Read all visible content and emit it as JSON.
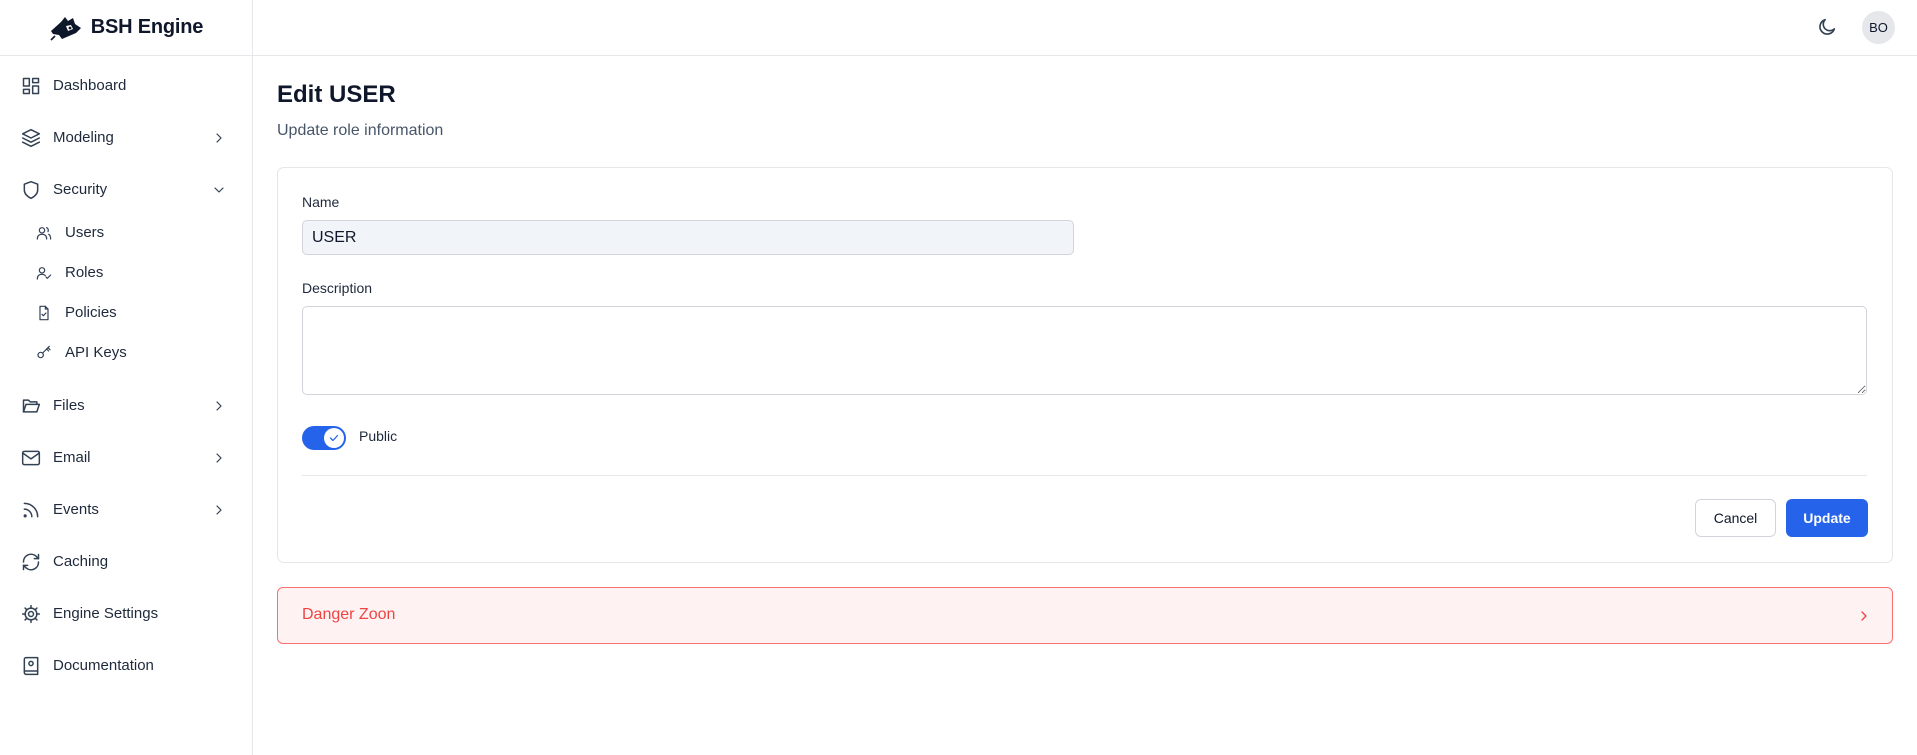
{
  "app": {
    "name": "BSH Engine"
  },
  "sidebar": {
    "items": [
      {
        "label": "Dashboard",
        "icon": "dashboard-icon"
      },
      {
        "label": "Modeling",
        "icon": "layers-icon",
        "expandable": true
      },
      {
        "label": "Security",
        "icon": "shield-icon",
        "expanded": true,
        "children": [
          {
            "label": "Users",
            "icon": "users-icon"
          },
          {
            "label": "Roles",
            "icon": "user-check-icon"
          },
          {
            "label": "Policies",
            "icon": "file-check-icon"
          },
          {
            "label": "API Keys",
            "icon": "key-icon"
          }
        ]
      },
      {
        "label": "Files",
        "icon": "folder-open-icon",
        "expandable": true
      },
      {
        "label": "Email",
        "icon": "mail-icon",
        "expandable": true
      },
      {
        "label": "Events",
        "icon": "rss-icon",
        "expandable": true
      },
      {
        "label": "Caching",
        "icon": "refresh-icon"
      },
      {
        "label": "Engine Settings",
        "icon": "gear-icon"
      },
      {
        "label": "Documentation",
        "icon": "book-icon"
      }
    ]
  },
  "topbar": {
    "theme_icon": "moon-icon",
    "avatar_initials": "BO"
  },
  "page": {
    "title": "Edit USER",
    "subtitle": "Update role information"
  },
  "form": {
    "name_label": "Name",
    "name_value": "USER",
    "description_label": "Description",
    "description_value": "",
    "public_label": "Public",
    "public_enabled": true,
    "cancel_label": "Cancel",
    "update_label": "Update"
  },
  "danger_zone": {
    "label": "Danger Zoon"
  },
  "colors": {
    "accent": "#2563eb",
    "danger": "#ef4444",
    "danger_bg": "#fef2f2"
  }
}
